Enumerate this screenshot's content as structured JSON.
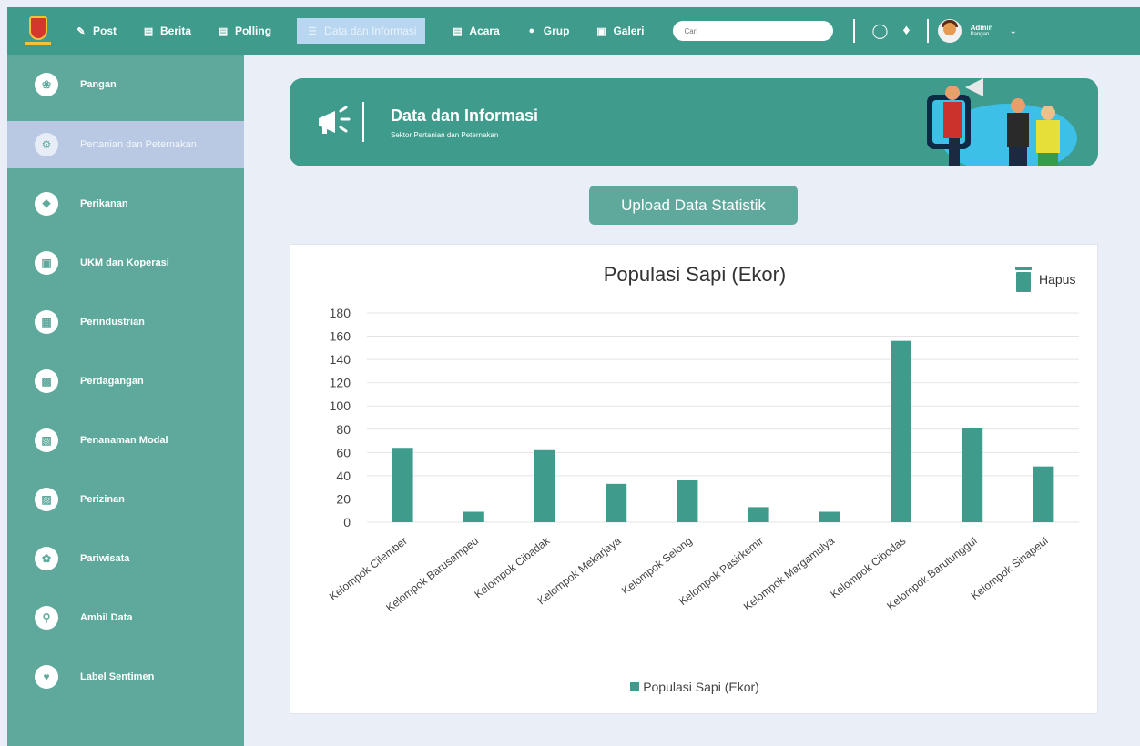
{
  "nav": {
    "items": [
      {
        "label": "Post",
        "icon": "post-icon"
      },
      {
        "label": "Berita",
        "icon": "news-icon"
      },
      {
        "label": "Polling",
        "icon": "poll-icon"
      },
      {
        "label": "Data dan Informasi",
        "icon": "list-icon"
      },
      {
        "label": "Acara",
        "icon": "calendar-icon"
      },
      {
        "label": "Grup",
        "icon": "group-icon"
      },
      {
        "label": "Galeri",
        "icon": "image-icon"
      }
    ],
    "search_placeholder": "Cari",
    "user_name": "Admin",
    "user_role": "Pangan"
  },
  "sidebar": {
    "items": [
      {
        "label": "Pangan",
        "icon": "leaf-icon"
      },
      {
        "label": "Pertanian dan Peternakan",
        "icon": "tractor-icon"
      },
      {
        "label": "Perikanan",
        "icon": "fish-icon"
      },
      {
        "label": "UKM dan Koperasi",
        "icon": "shop-icon"
      },
      {
        "label": "Perindustrian",
        "icon": "factory-icon"
      },
      {
        "label": "Perdagangan",
        "icon": "store-icon"
      },
      {
        "label": "Penanaman Modal",
        "icon": "investment-icon"
      },
      {
        "label": "Perizinan",
        "icon": "permit-icon"
      },
      {
        "label": "Pariwisata",
        "icon": "tourism-icon"
      },
      {
        "label": "Ambil Data",
        "icon": "globe-search-icon"
      },
      {
        "label": "Label Sentimen",
        "icon": "sentiment-icon"
      }
    ]
  },
  "banner": {
    "title": "Data dan Informasi",
    "subtitle": "Sektor Pertanian dan Peternakan"
  },
  "upload_label": "Upload Data Statistik",
  "delete_label": "Hapus",
  "colors": {
    "primary": "#3f9b8c",
    "sidebar": "#5ea99c",
    "active": "#b9c9e3",
    "background": "#e9eef7"
  },
  "chart_data": {
    "type": "bar",
    "title": "Populasi Sapi (Ekor)",
    "categories": [
      "Kelompok Cilember",
      "Kelompok Barusampeu",
      "Kelompok Cibadak",
      "Kelompok Mekarjaya",
      "Kelompok Selong",
      "Kelompok Pasirkemir",
      "Kelompok Margamulya",
      "Kelompok Cibodas",
      "Kelompok Barutunggul",
      "Kelompok Sinapeul"
    ],
    "series": [
      {
        "name": "Populasi Sapi (Ekor)",
        "values": [
          64,
          9,
          62,
          33,
          36,
          13,
          9,
          156,
          81,
          48
        ]
      }
    ],
    "yticks": [
      "0",
      "20",
      "40",
      "60",
      "80",
      "100",
      "120",
      "140",
      "160",
      "180"
    ],
    "ylim": [
      0,
      180
    ],
    "grid": true,
    "legend": "bottom",
    "color": "#3f9b8c"
  }
}
